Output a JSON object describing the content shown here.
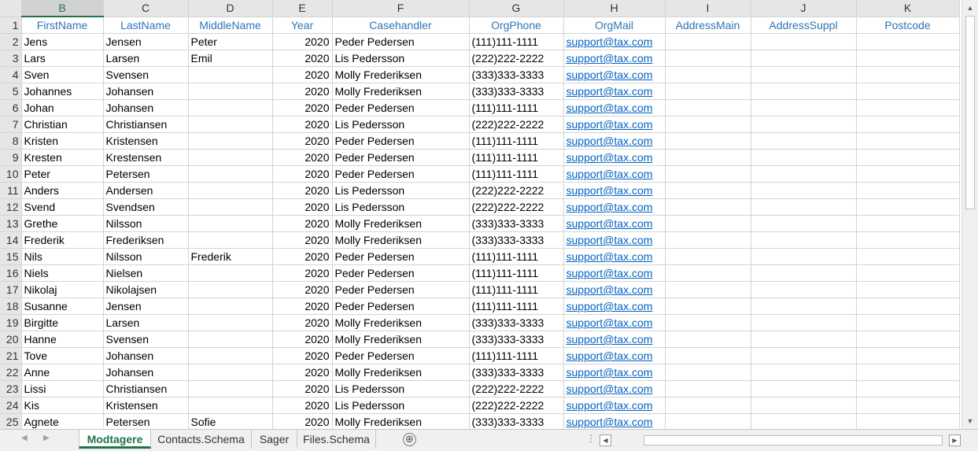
{
  "columns": [
    "B",
    "C",
    "D",
    "E",
    "F",
    "G",
    "H",
    "I",
    "J",
    "K"
  ],
  "active_column": "B",
  "header_row": {
    "row_number": "1",
    "cells": [
      "FirstName",
      "LastName",
      "MiddleName",
      "Year",
      "Casehandler",
      "OrgPhone",
      "OrgMail",
      "AddressMain",
      "AddressSuppl",
      "Postcode"
    ]
  },
  "rows": [
    {
      "n": "2",
      "first": "Jens",
      "last": "Jensen",
      "middle": "Peter",
      "year": "2020",
      "handler": "Peder Pedersen",
      "phone": "(111)111-1111",
      "mail": "support@tax.com"
    },
    {
      "n": "3",
      "first": "Lars",
      "last": "Larsen",
      "middle": "Emil",
      "year": "2020",
      "handler": "Lis Pedersson",
      "phone": "(222)222-2222",
      "mail": "support@tax.com"
    },
    {
      "n": "4",
      "first": "Sven",
      "last": "Svensen",
      "middle": "",
      "year": "2020",
      "handler": "Molly Frederiksen",
      "phone": "(333)333-3333",
      "mail": "support@tax.com"
    },
    {
      "n": "5",
      "first": "Johannes",
      "last": "Johansen",
      "middle": "",
      "year": "2020",
      "handler": "Molly Frederiksen",
      "phone": "(333)333-3333",
      "mail": "support@tax.com"
    },
    {
      "n": "6",
      "first": "Johan",
      "last": "Johansen",
      "middle": "",
      "year": "2020",
      "handler": "Peder Pedersen",
      "phone": "(111)111-1111",
      "mail": "support@tax.com"
    },
    {
      "n": "7",
      "first": "Christian",
      "last": "Christiansen",
      "middle": "",
      "year": "2020",
      "handler": "Lis Pedersson",
      "phone": "(222)222-2222",
      "mail": "support@tax.com"
    },
    {
      "n": "8",
      "first": "Kristen",
      "last": "Kristensen",
      "middle": "",
      "year": "2020",
      "handler": "Peder Pedersen",
      "phone": "(111)111-1111",
      "mail": "support@tax.com"
    },
    {
      "n": "9",
      "first": "Kresten",
      "last": "Krestensen",
      "middle": "",
      "year": "2020",
      "handler": "Peder Pedersen",
      "phone": "(111)111-1111",
      "mail": "support@tax.com"
    },
    {
      "n": "10",
      "first": "Peter",
      "last": "Petersen",
      "middle": "",
      "year": "2020",
      "handler": "Peder Pedersen",
      "phone": "(111)111-1111",
      "mail": "support@tax.com"
    },
    {
      "n": "11",
      "first": "Anders",
      "last": "Andersen",
      "middle": "",
      "year": "2020",
      "handler": "Lis Pedersson",
      "phone": "(222)222-2222",
      "mail": "support@tax.com"
    },
    {
      "n": "12",
      "first": "Svend",
      "last": "Svendsen",
      "middle": "",
      "year": "2020",
      "handler": "Lis Pedersson",
      "phone": "(222)222-2222",
      "mail": "support@tax.com"
    },
    {
      "n": "13",
      "first": "Grethe",
      "last": "Nilsson",
      "middle": "",
      "year": "2020",
      "handler": "Molly Frederiksen",
      "phone": "(333)333-3333",
      "mail": "support@tax.com"
    },
    {
      "n": "14",
      "first": "Frederik",
      "last": "Frederiksen",
      "middle": "",
      "year": "2020",
      "handler": "Molly Frederiksen",
      "phone": "(333)333-3333",
      "mail": "support@tax.com"
    },
    {
      "n": "15",
      "first": "Nils",
      "last": "Nilsson",
      "middle": "Frederik",
      "year": "2020",
      "handler": "Peder Pedersen",
      "phone": "(111)111-1111",
      "mail": "support@tax.com"
    },
    {
      "n": "16",
      "first": "Niels",
      "last": "Nielsen",
      "middle": "",
      "year": "2020",
      "handler": "Peder Pedersen",
      "phone": "(111)111-1111",
      "mail": "support@tax.com"
    },
    {
      "n": "17",
      "first": "Nikolaj",
      "last": "Nikolajsen",
      "middle": "",
      "year": "2020",
      "handler": "Peder Pedersen",
      "phone": "(111)111-1111",
      "mail": "support@tax.com"
    },
    {
      "n": "18",
      "first": "Susanne",
      "last": "Jensen",
      "middle": "",
      "year": "2020",
      "handler": "Peder Pedersen",
      "phone": "(111)111-1111",
      "mail": "support@tax.com"
    },
    {
      "n": "19",
      "first": "Birgitte",
      "last": "Larsen",
      "middle": "",
      "year": "2020",
      "handler": "Molly Frederiksen",
      "phone": "(333)333-3333",
      "mail": "support@tax.com"
    },
    {
      "n": "20",
      "first": "Hanne",
      "last": "Svensen",
      "middle": "",
      "year": "2020",
      "handler": "Molly Frederiksen",
      "phone": "(333)333-3333",
      "mail": "support@tax.com"
    },
    {
      "n": "21",
      "first": "Tove",
      "last": "Johansen",
      "middle": "",
      "year": "2020",
      "handler": "Peder Pedersen",
      "phone": "(111)111-1111",
      "mail": "support@tax.com"
    },
    {
      "n": "22",
      "first": "Anne",
      "last": "Johansen",
      "middle": "",
      "year": "2020",
      "handler": "Molly Frederiksen",
      "phone": "(333)333-3333",
      "mail": "support@tax.com"
    },
    {
      "n": "23",
      "first": "Lissi",
      "last": "Christiansen",
      "middle": "",
      "year": "2020",
      "handler": "Lis Pedersson",
      "phone": "(222)222-2222",
      "mail": "support@tax.com"
    },
    {
      "n": "24",
      "first": "Kis",
      "last": "Kristensen",
      "middle": "",
      "year": "2020",
      "handler": "Lis Pedersson",
      "phone": "(222)222-2222",
      "mail": "support@tax.com"
    },
    {
      "n": "25",
      "first": "Agnete",
      "last": "Petersen",
      "middle": "Sofie",
      "year": "2020",
      "handler": "Molly Frederiksen",
      "phone": "(333)333-3333",
      "mail": "support@tax.com"
    }
  ],
  "sheet_tabs": [
    "Modtagere",
    "Contacts.Schema",
    "Sager",
    "Files.Schema"
  ],
  "active_tab": "Modtagere",
  "add_sheet_symbol": "⊕",
  "colors": {
    "accent": "#217346",
    "header_text": "#2e75b6",
    "link": "#0563c1"
  }
}
